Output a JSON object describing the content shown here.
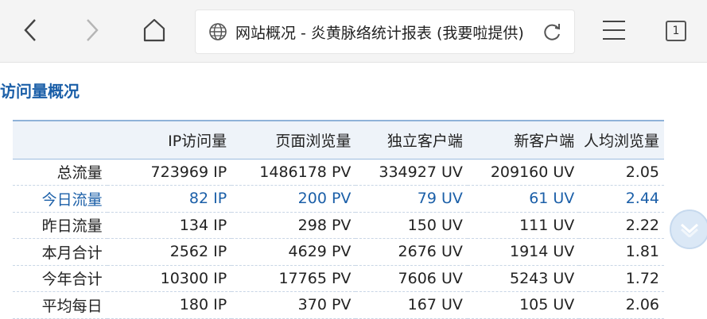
{
  "browser": {
    "page_title": "网站概况 - 炎黄脉络统计报表 (我要啦提供)",
    "tab_count": "1"
  },
  "section": {
    "title": "访问量概况"
  },
  "table": {
    "headers": [
      "",
      "IP访问量",
      "页面浏览量",
      "独立客户端",
      "新客户端",
      "人均浏览量"
    ],
    "rows": [
      {
        "label": "总流量",
        "ip": "723969 IP",
        "pv": "1486178 PV",
        "uv": "334927 UV",
        "new_uv": "209160 UV",
        "avg": "2.05"
      },
      {
        "label": "今日流量",
        "ip": "82 IP",
        "pv": "200 PV",
        "uv": "79 UV",
        "new_uv": "61 UV",
        "avg": "2.44"
      },
      {
        "label": "昨日流量",
        "ip": "134 IP",
        "pv": "298 PV",
        "uv": "150 UV",
        "new_uv": "111 UV",
        "avg": "2.22"
      },
      {
        "label": "本月合计",
        "ip": "2562 IP",
        "pv": "4629 PV",
        "uv": "2676 UV",
        "new_uv": "1914 UV",
        "avg": "1.81"
      },
      {
        "label": "今年合计",
        "ip": "10300 IP",
        "pv": "17765 PV",
        "uv": "7606 UV",
        "new_uv": "5243 UV",
        "avg": "1.72"
      },
      {
        "label": "平均每日",
        "ip": "180 IP",
        "pv": "370 PV",
        "uv": "167 UV",
        "new_uv": "105 UV",
        "avg": "2.06"
      }
    ]
  },
  "colors": {
    "accent": "#1b5fa8",
    "header_bg": "#eef3f9"
  },
  "icons": [
    "back-icon",
    "forward-icon",
    "home-icon",
    "globe-icon",
    "reload-icon",
    "menu-icon",
    "tabs-icon",
    "scroll-down-icon"
  ]
}
